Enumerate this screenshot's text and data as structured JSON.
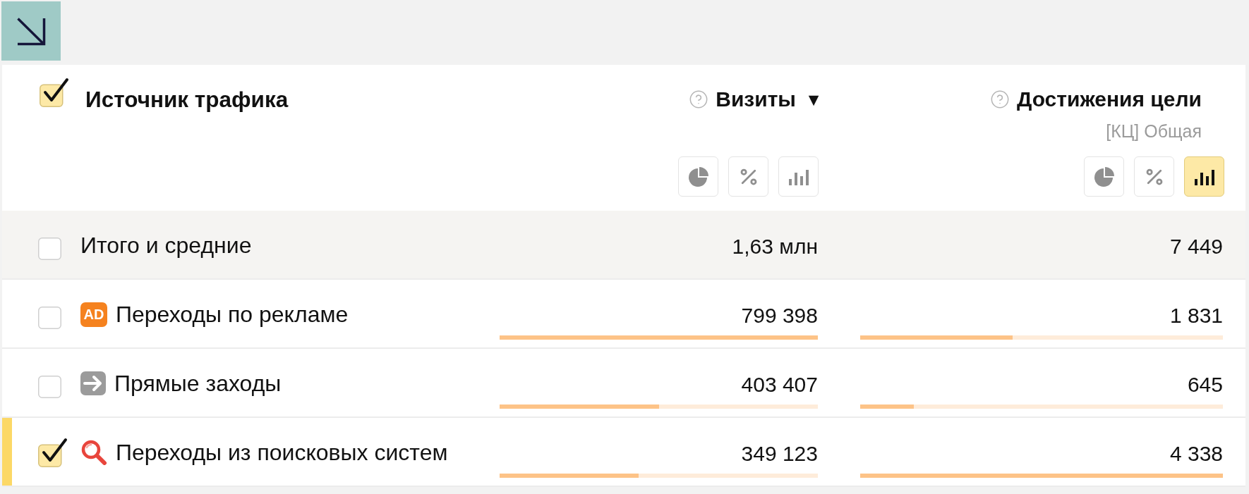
{
  "table": {
    "header": {
      "checked": true,
      "title": "Источник трафика"
    },
    "columns": [
      {
        "title": "Визиты",
        "sort_indicator": "▼",
        "views": [
          {
            "kind": "pie",
            "selected": false
          },
          {
            "kind": "percent",
            "selected": false
          },
          {
            "kind": "bars",
            "selected": false
          }
        ]
      },
      {
        "title": "Достижения цели",
        "subtitle": "[КЦ] Общая",
        "views": [
          {
            "kind": "pie",
            "selected": false
          },
          {
            "kind": "percent",
            "selected": false
          },
          {
            "kind": "bars",
            "selected": true
          }
        ]
      }
    ],
    "rows": [
      {
        "kind": "total",
        "checked": false,
        "label": "Итого и средние",
        "cells": [
          {
            "value": "1,63 млн"
          },
          {
            "value": "7 449"
          }
        ]
      },
      {
        "kind": "source",
        "checked": false,
        "icon": {
          "kind": "badge",
          "text": "AD"
        },
        "label": "Переходы по рекламе",
        "cells": [
          {
            "value": "799 398",
            "level": 1
          },
          {
            "value": "1 831",
            "level": 0.42
          }
        ]
      },
      {
        "kind": "source",
        "checked": false,
        "icon": {
          "kind": "arrow"
        },
        "label": "Прямые заходы",
        "cells": [
          {
            "value": "403 407",
            "level": 0.5
          },
          {
            "value": "645",
            "level": 0.148
          }
        ]
      },
      {
        "kind": "source",
        "checked": true,
        "icon": {
          "kind": "search"
        },
        "label": "Переходы из поисковых систем",
        "cells": [
          {
            "value": "349 123",
            "level": 0.437
          },
          {
            "value": "4 338",
            "level": 1
          }
        ]
      }
    ]
  }
}
